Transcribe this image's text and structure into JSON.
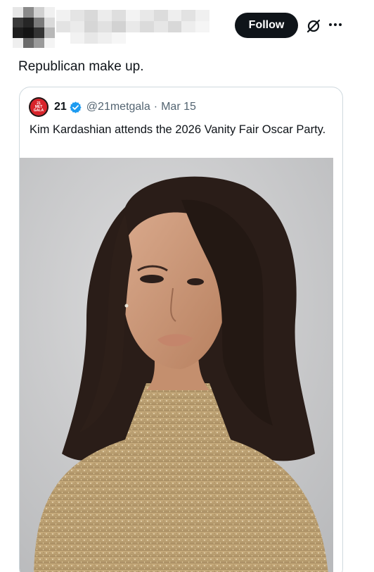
{
  "header": {
    "follow_label": "Follow",
    "grok_icon": "grok-slash-circle-icon",
    "more_icon": "more-dots-icon"
  },
  "post": {
    "text": "Republican make up."
  },
  "quoted": {
    "name": "21",
    "handle": "@21metgala",
    "separator": "·",
    "date": "Mar 15",
    "avatar_logo": "21 MET GALA",
    "text": "Kim Kardashian attends the 2026 Vanity Fair Oscar Party.",
    "verified_icon": "verified-badge-icon",
    "verified_color": "#1d9bf0"
  },
  "colors": {
    "follow_bg": "#0f1419",
    "muted_text": "#536471",
    "border": "#cfd9de"
  }
}
